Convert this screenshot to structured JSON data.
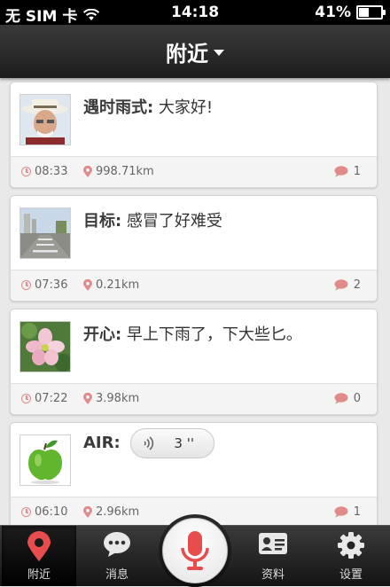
{
  "status_bar": {
    "carrier": "无 SIM 卡",
    "time": "14:18",
    "battery": "41%",
    "battery_level": 0.41
  },
  "nav": {
    "title": "附近"
  },
  "feed": [
    {
      "name": "遇时雨式:",
      "text": " 大家好!",
      "time": "08:33",
      "distance": "998.71km",
      "comments": "1",
      "thumb": "avatar-man-with-hat"
    },
    {
      "name": "目标:",
      "text": " 感冒了好难受",
      "time": "07:36",
      "distance": "0.21km",
      "comments": "2",
      "thumb": "street-photo"
    },
    {
      "name": "开心:",
      "text": " 早上下雨了，下大些匕。",
      "time": "07:22",
      "distance": "3.98km",
      "comments": "0",
      "thumb": "flower-photo"
    },
    {
      "name": "AIR:",
      "text": "",
      "voice_duration": "3 ''",
      "time": "06:10",
      "distance": "2.96km",
      "comments": "1",
      "thumb": "green-apple"
    }
  ],
  "tabs": [
    {
      "label": "附近",
      "icon": "location-pin-icon",
      "active": true
    },
    {
      "label": "消息",
      "icon": "chat-bubble-icon",
      "active": false
    },
    {
      "label": "",
      "icon": "microphone-icon",
      "active": false
    },
    {
      "label": "资料",
      "icon": "profile-card-icon",
      "active": false
    },
    {
      "label": "设置",
      "icon": "gear-icon",
      "active": false
    }
  ],
  "colors": {
    "accent": "#e84d4d",
    "icon_pink": "#e08a8a",
    "nav_dark": "#262626"
  }
}
